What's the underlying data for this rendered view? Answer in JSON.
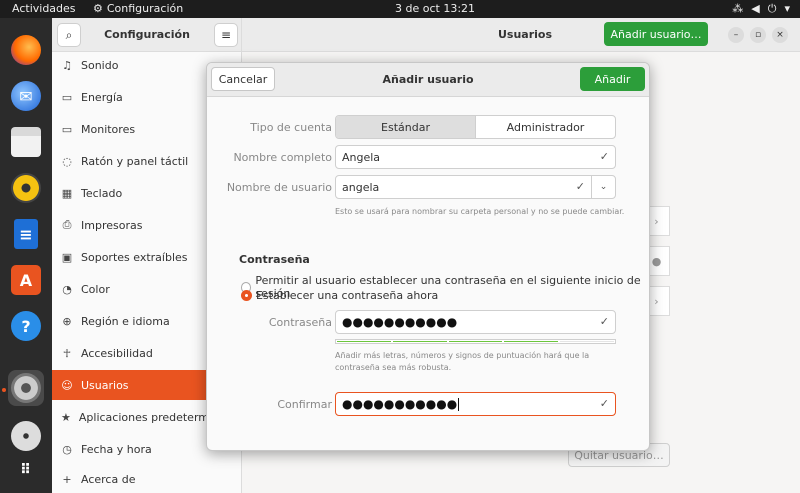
{
  "topbar": {
    "activities": "Actividades",
    "app_name": "Configuración",
    "clock": "3 de oct  13:21"
  },
  "dock": {
    "items": [
      "firefox",
      "thunderbird",
      "files",
      "rhythmbox",
      "writer",
      "app-center",
      "help",
      "settings",
      "disc",
      "app-grid"
    ]
  },
  "sidebar": {
    "title": "Configuración",
    "items": [
      {
        "label": "Sonido",
        "icon": "music-note-icon"
      },
      {
        "label": "Energía",
        "icon": "battery-icon"
      },
      {
        "label": "Monitores",
        "icon": "monitor-icon"
      },
      {
        "label": "Ratón y panel táctil",
        "icon": "mouse-icon"
      },
      {
        "label": "Teclado",
        "icon": "keyboard-icon"
      },
      {
        "label": "Impresoras",
        "icon": "printer-icon"
      },
      {
        "label": "Soportes extraíbles",
        "icon": "removable-media-icon"
      },
      {
        "label": "Color",
        "icon": "color-icon"
      },
      {
        "label": "Región e idioma",
        "icon": "globe-icon"
      },
      {
        "label": "Accesibilidad",
        "icon": "accessibility-icon"
      },
      {
        "label": "Usuarios",
        "icon": "users-icon"
      },
      {
        "label": "Aplicaciones predeterminadas",
        "icon": "star-icon"
      },
      {
        "label": "Fecha y hora",
        "icon": "clock-icon"
      },
      {
        "label": "Acerca de",
        "icon": "plus-icon"
      }
    ],
    "selected_index": 10
  },
  "main": {
    "title": "Usuarios",
    "add_user_label": "Añadir usuario…",
    "remove_user_label": "Quitar usuario…"
  },
  "dialog": {
    "cancel_label": "Cancelar",
    "title": "Añadir usuario",
    "add_label": "Añadir",
    "account_type_label": "Tipo de cuenta",
    "account_types": [
      "Estándar",
      "Administrador"
    ],
    "full_name_label": "Nombre completo",
    "full_name_value": "Angela",
    "username_label": "Nombre de usuario",
    "username_value": "angela",
    "username_hint": "Esto se usará para nombrar su carpeta personal y no se puede cambiar.",
    "password_section": "Contraseña",
    "radio_next_login": "Permitir al usuario establecer una contraseña en el siguiente inicio de sesión",
    "radio_now": "Establecer una contraseña ahora",
    "password_label": "Contraseña",
    "password_value": "●●●●●●●●●●●",
    "password_strength": 0.8,
    "password_hint_1": "Añadir más letras, números y signos de puntuación hará que la",
    "password_hint_2": "contraseña sea más robusta.",
    "confirm_label": "Confirmar",
    "confirm_value": "●●●●●●●●●●●"
  }
}
